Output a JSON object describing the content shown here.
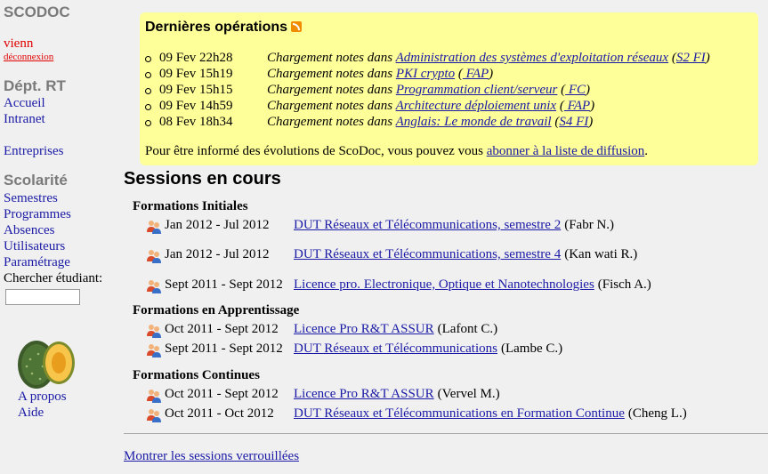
{
  "sidebar": {
    "brand": "SCODOC",
    "user": "vienn",
    "logout": "déconnexion",
    "dept": "Dépt. RT",
    "links": [
      "Accueil",
      "Intranet",
      "Entreprises"
    ],
    "scolarite": "Scolarité",
    "scol_links": [
      "Semestres",
      "Programmes",
      "Absences",
      "Utilisateurs",
      "Paramétrage"
    ],
    "search_label": "Chercher étudiant:",
    "search_value": "",
    "bottom_links": [
      "A propos",
      "Aide"
    ]
  },
  "ops": {
    "title": "Dernières opérations",
    "rows": [
      {
        "date": "09 Fev 22h28",
        "prefix": "Chargement notes dans",
        "module": "Administration des systèmes d'exploitation réseaux",
        "group": "S2 FI"
      },
      {
        "date": "09 Fev 15h19",
        "prefix": "Chargement notes dans",
        "module": "PKI crypto",
        "group": " FAP"
      },
      {
        "date": "09 Fev 15h15",
        "prefix": "Chargement notes dans",
        "module": "Programmation client/serveur",
        "group": " FC"
      },
      {
        "date": "09 Fev 14h59",
        "prefix": "Chargement notes dans",
        "module": "Architecture déploiement unix",
        "group": " FAP"
      },
      {
        "date": "08 Fev 18h34",
        "prefix": "Chargement notes dans",
        "module": "Anglais: Le monde de travail",
        "group": "S4 FI"
      }
    ],
    "footer_text": "Pour être informé des évolutions de ScoDoc, vous pouvez vous",
    "footer_link": "abonner à la liste de diffusion",
    "footer_end": "."
  },
  "sessions": {
    "title": "Sessions en cours",
    "groups": [
      {
        "title": "Formations Initiales",
        "items": [
          {
            "dates": "Jan 2012   - Jul 2012",
            "title": "DUT Réseaux et Télécommunications, semestre 2",
            "resp": "(Fabr   N.)"
          },
          {
            "dates": "Jan 2012   - Jul 2012",
            "title": "DUT Réseaux et Télécommunications, semestre 4",
            "resp": "(Kan  wati R.)"
          },
          {
            "dates": "Sept 2011 - Sept 2012",
            "title": "Licence pro. Electronique, Optique et Nanotechnologies",
            "resp": "(Fisch    A.)"
          }
        ]
      },
      {
        "title": "Formations en Apprentissage",
        "items": [
          {
            "dates": "Oct 2011   - Sept 2012",
            "title": "Licence Pro R&T ASSUR",
            "resp": "(Lafont C.)"
          },
          {
            "dates": "Sept 2011 - Sept 2012",
            "title": "DUT Réseaux et Télécommunications",
            "resp": "(Lambe C.)"
          }
        ]
      },
      {
        "title": "Formations Continues",
        "items": [
          {
            "dates": "Oct 2011   - Sept 2012",
            "title": "Licence Pro R&T ASSUR",
            "resp": "(Vervel M.)"
          },
          {
            "dates": "Oct 2011   - Oct 2012",
            "title": "DUT Réseaux et Télécommunications en Formation Continue",
            "resp": "(Cheng       L.)"
          }
        ]
      }
    ],
    "show_locked": "Montrer les sessions verrouillées"
  },
  "icons": {
    "rss": "rss-feed-icon",
    "group": "users-group-icon",
    "logo": "scodoc-melon-logo"
  }
}
